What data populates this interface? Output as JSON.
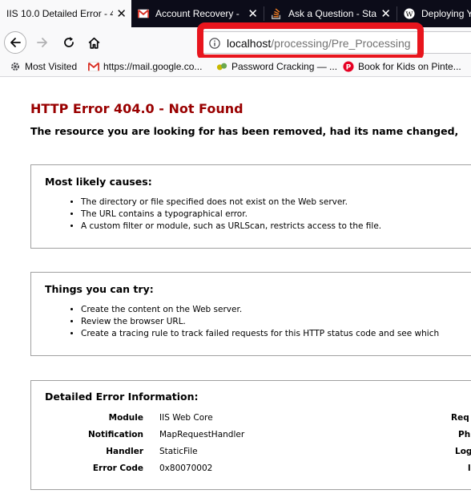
{
  "tabs": [
    {
      "title": "IIS 10.0 Detailed Error - 4",
      "active": true
    },
    {
      "title": "Account Recovery - ",
      "icon": "gmail-icon"
    },
    {
      "title": "Ask a Question - Sta",
      "icon": "stackoverflow-icon"
    },
    {
      "title": "Deploying Y",
      "icon": "wikipedia-icon"
    }
  ],
  "nav": {
    "url_host": "localhost",
    "url_path": "/processing/Pre_Processing"
  },
  "bookmarks": [
    {
      "label": "Most Visited",
      "icon": "gear-icon"
    },
    {
      "label": "https://mail.google.co...",
      "icon": "gmail-icon"
    },
    {
      "label": "Password Cracking — ...",
      "icon": "bookmark-icon"
    },
    {
      "label": "Book for Kids on Pinte...",
      "icon": "pinterest-icon"
    }
  ],
  "page": {
    "title": "HTTP Error 404.0 - Not Found",
    "subtitle": "The resource you are looking for has been removed, had its name changed,",
    "causes": {
      "heading": "Most likely causes:",
      "items": [
        "The directory or file specified does not exist on the Web server.",
        "The URL contains a typographical error.",
        "A custom filter or module, such as URLScan, restricts access to the file."
      ]
    },
    "try": {
      "heading": "Things you can try:",
      "items": [
        "Create the content on the Web server.",
        "Review the browser URL.",
        "Create a tracing rule to track failed requests for this HTTP status code and see which"
      ]
    },
    "details": {
      "heading": "Detailed Error Information:",
      "rows": [
        {
          "key": "Module",
          "value": "IIS Web Core",
          "right_key": "Req"
        },
        {
          "key": "Notification",
          "value": "MapRequestHandler",
          "right_key": "Ph"
        },
        {
          "key": "Handler",
          "value": "StaticFile",
          "right_key": "Log"
        },
        {
          "key": "Error Code",
          "value": "0x80070002",
          "right_key": "l"
        }
      ]
    }
  },
  "colors": {
    "error_title": "#990000",
    "highlight": "#e8151d",
    "tabstrip": "#0c0c19"
  }
}
